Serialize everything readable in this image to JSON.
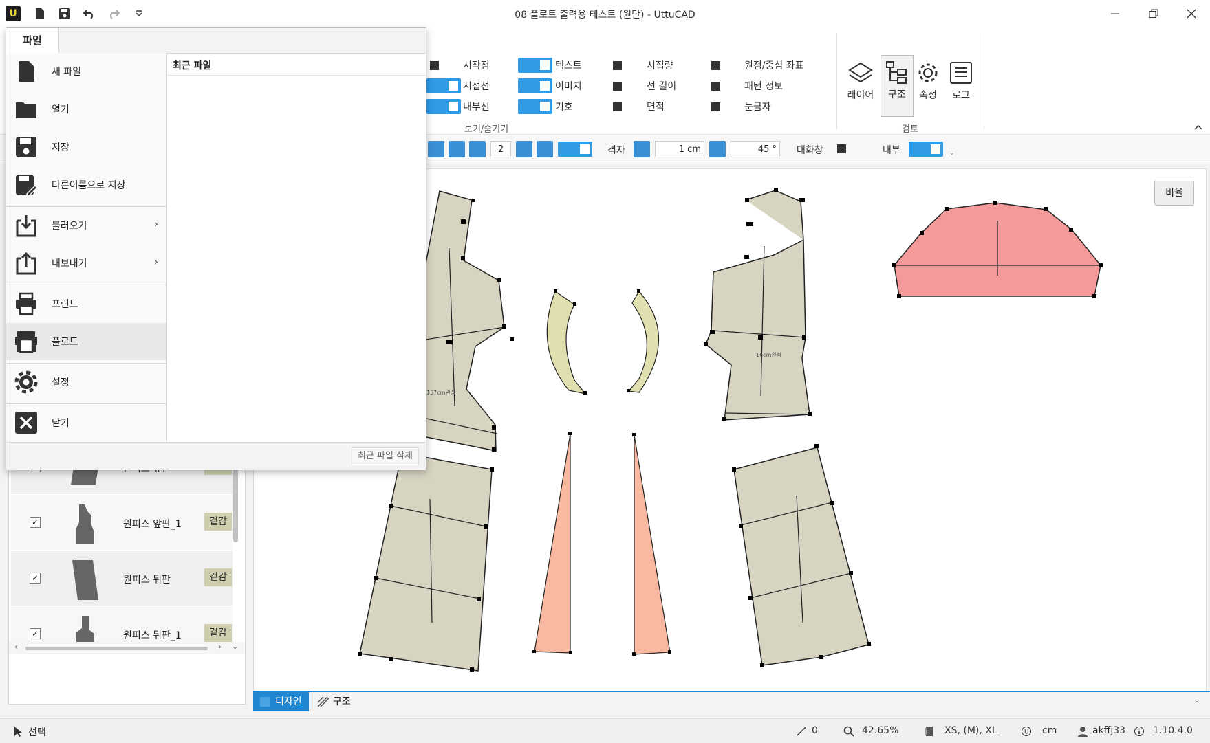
{
  "app": {
    "title": "08 플로트 출력용 테스트 (원단) - UttuCAD",
    "logo_letter": "U"
  },
  "view_options": {
    "col1": [
      "시작점",
      "시접선",
      "내부선"
    ],
    "col2": [
      "텍스트",
      "이미지",
      "기호"
    ],
    "col3": [
      "시접량",
      "선 길이",
      "면적"
    ],
    "col4": [
      "원점/중심 좌표",
      "패턴 정보",
      "눈금자"
    ],
    "group_label": "보기/숨기기"
  },
  "review": {
    "buttons": [
      "레이어",
      "구조",
      "속성",
      "로그"
    ],
    "group_label": "검토"
  },
  "toolbar": {
    "count_value": "2",
    "grid_label": "격자",
    "grid_value": "1 cm",
    "angle_value": "45 °",
    "dialog_label": "대화창",
    "inner_label": "내부"
  },
  "pieces": [
    {
      "name": "원피스 앞판",
      "tag": "겉감",
      "checked": "✓"
    },
    {
      "name": "원피스 앞판_1",
      "tag": "겉감",
      "checked": "✓"
    },
    {
      "name": "원피스 뒤판",
      "tag": "겉감",
      "checked": "✓"
    },
    {
      "name": "원피스 뒤판_1",
      "tag": "겉감",
      "checked": "✓"
    }
  ],
  "canvas": {
    "ratio_button": "비율",
    "pattern_labels": [
      "157cm완성",
      "16cm완성"
    ]
  },
  "bottom_tabs": [
    "디자인",
    "구조"
  ],
  "status": {
    "mode": "선택",
    "line_count": "0",
    "zoom": "42.65%",
    "sizes": "XS, (M), XL",
    "unit": "cm",
    "user": "akffj33",
    "version": "1.10.4.0"
  },
  "file_menu": {
    "tab": "파일",
    "items": [
      "새 파일",
      "열기",
      "저장",
      "다른이름으로 저장",
      "불러오기",
      "내보내기",
      "프린트",
      "플로트",
      "설정",
      "닫기"
    ],
    "recent_title": "최근 파일",
    "clear_recent": "최근 파일 삭제"
  },
  "colors": {
    "accent": "#2f9ae6",
    "fabric": "#d7d4c1",
    "facing": "#e0dfb0",
    "dart": "#f9b8a0",
    "sleeve": "#f59a9a"
  }
}
